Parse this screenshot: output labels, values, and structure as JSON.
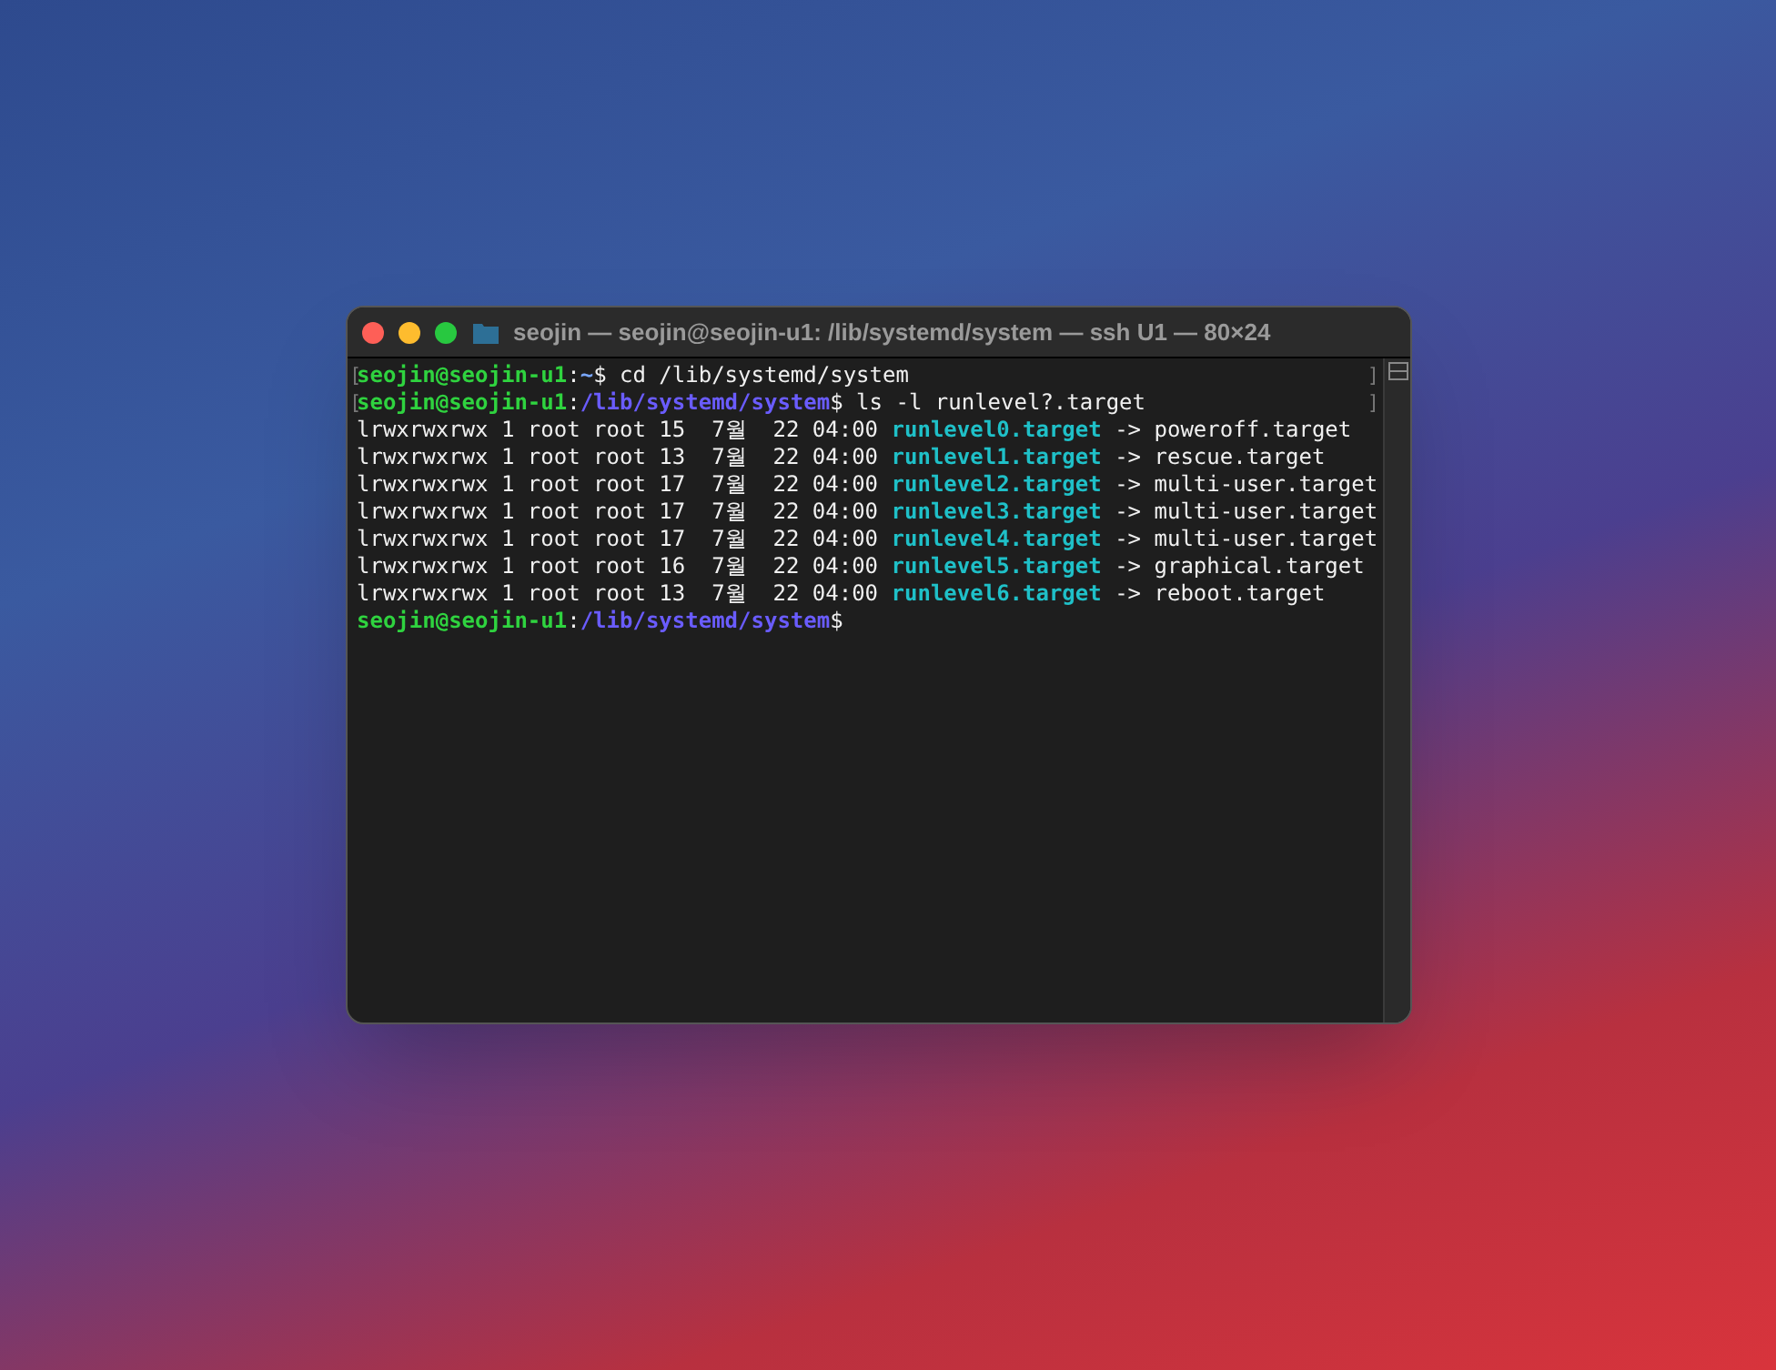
{
  "window": {
    "title": "seojin — seojin@seojin-u1: /lib/systemd/system — ssh U1 — 80×24"
  },
  "lines": [
    {
      "left_mark": "[",
      "right_mark": "]",
      "segments": [
        {
          "text": "seojin@seojin-u1",
          "kind": "user"
        },
        {
          "text": ":",
          "kind": "plain"
        },
        {
          "text": "~",
          "kind": "home"
        },
        {
          "text": "$ cd /lib/systemd/system",
          "kind": "plain"
        }
      ]
    },
    {
      "left_mark": "[",
      "right_mark": "]",
      "segments": [
        {
          "text": "seojin@seojin-u1",
          "kind": "user"
        },
        {
          "text": ":",
          "kind": "plain"
        },
        {
          "text": "/lib/systemd/system",
          "kind": "path"
        },
        {
          "text": "$ ls -l runlevel?.target",
          "kind": "plain"
        }
      ]
    },
    {
      "segments": [
        {
          "text": "lrwxrwxrwx 1 root root 15  7월  22 04:00 ",
          "kind": "plain"
        },
        {
          "text": "runlevel0.target",
          "kind": "link"
        },
        {
          "text": " -> poweroff.target",
          "kind": "plain"
        }
      ]
    },
    {
      "segments": [
        {
          "text": "lrwxrwxrwx 1 root root 13  7월  22 04:00 ",
          "kind": "plain"
        },
        {
          "text": "runlevel1.target",
          "kind": "link"
        },
        {
          "text": " -> rescue.target",
          "kind": "plain"
        }
      ]
    },
    {
      "segments": [
        {
          "text": "lrwxrwxrwx 1 root root 17  7월  22 04:00 ",
          "kind": "plain"
        },
        {
          "text": "runlevel2.target",
          "kind": "link"
        },
        {
          "text": " -> multi-user.target",
          "kind": "plain"
        }
      ]
    },
    {
      "segments": [
        {
          "text": "lrwxrwxrwx 1 root root 17  7월  22 04:00 ",
          "kind": "plain"
        },
        {
          "text": "runlevel3.target",
          "kind": "link"
        },
        {
          "text": " -> multi-user.target",
          "kind": "plain"
        }
      ]
    },
    {
      "segments": [
        {
          "text": "lrwxrwxrwx 1 root root 17  7월  22 04:00 ",
          "kind": "plain"
        },
        {
          "text": "runlevel4.target",
          "kind": "link"
        },
        {
          "text": " -> multi-user.target",
          "kind": "plain"
        }
      ]
    },
    {
      "segments": [
        {
          "text": "lrwxrwxrwx 1 root root 16  7월  22 04:00 ",
          "kind": "plain"
        },
        {
          "text": "runlevel5.target",
          "kind": "link"
        },
        {
          "text": " -> graphical.target",
          "kind": "plain"
        }
      ]
    },
    {
      "segments": [
        {
          "text": "lrwxrwxrwx 1 root root 13  7월  22 04:00 ",
          "kind": "plain"
        },
        {
          "text": "runlevel6.target",
          "kind": "link"
        },
        {
          "text": " -> reboot.target",
          "kind": "plain"
        }
      ]
    },
    {
      "segments": [
        {
          "text": "seojin@seojin-u1",
          "kind": "user"
        },
        {
          "text": ":",
          "kind": "plain"
        },
        {
          "text": "/lib/systemd/system",
          "kind": "path"
        },
        {
          "text": "$",
          "kind": "plain"
        }
      ]
    }
  ]
}
